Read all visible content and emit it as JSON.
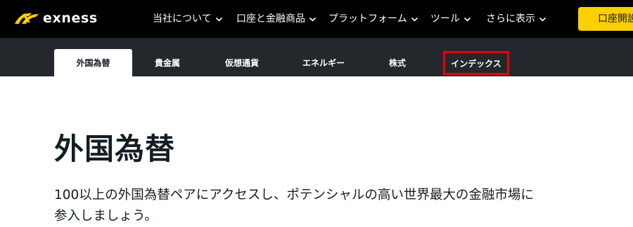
{
  "header": {
    "brand": "exness",
    "nav": [
      {
        "label": "当社について"
      },
      {
        "label": "口座と金融商品"
      },
      {
        "label": "プラットフォーム"
      },
      {
        "label": "ツール"
      },
      {
        "label": "さらに表示"
      }
    ],
    "cta_label": "口座開設"
  },
  "subnav": {
    "tabs": [
      {
        "label": "外国為替",
        "active": true
      },
      {
        "label": "貴金属"
      },
      {
        "label": "仮想通貨"
      },
      {
        "label": "エネルギー"
      },
      {
        "label": "株式"
      },
      {
        "label": "インデックス",
        "highlighted": true
      }
    ]
  },
  "main": {
    "title": "外国為替",
    "description": "100以上の外国為替ペアにアクセスし、ポテンシャルの高い世界最大の金融市場に参入しましょう。"
  },
  "colors": {
    "topbar": "#000000",
    "subnav": "#24272c",
    "brand_yellow": "#ffcf00",
    "highlight_red": "#e6000f",
    "text_dark": "#141d22"
  }
}
